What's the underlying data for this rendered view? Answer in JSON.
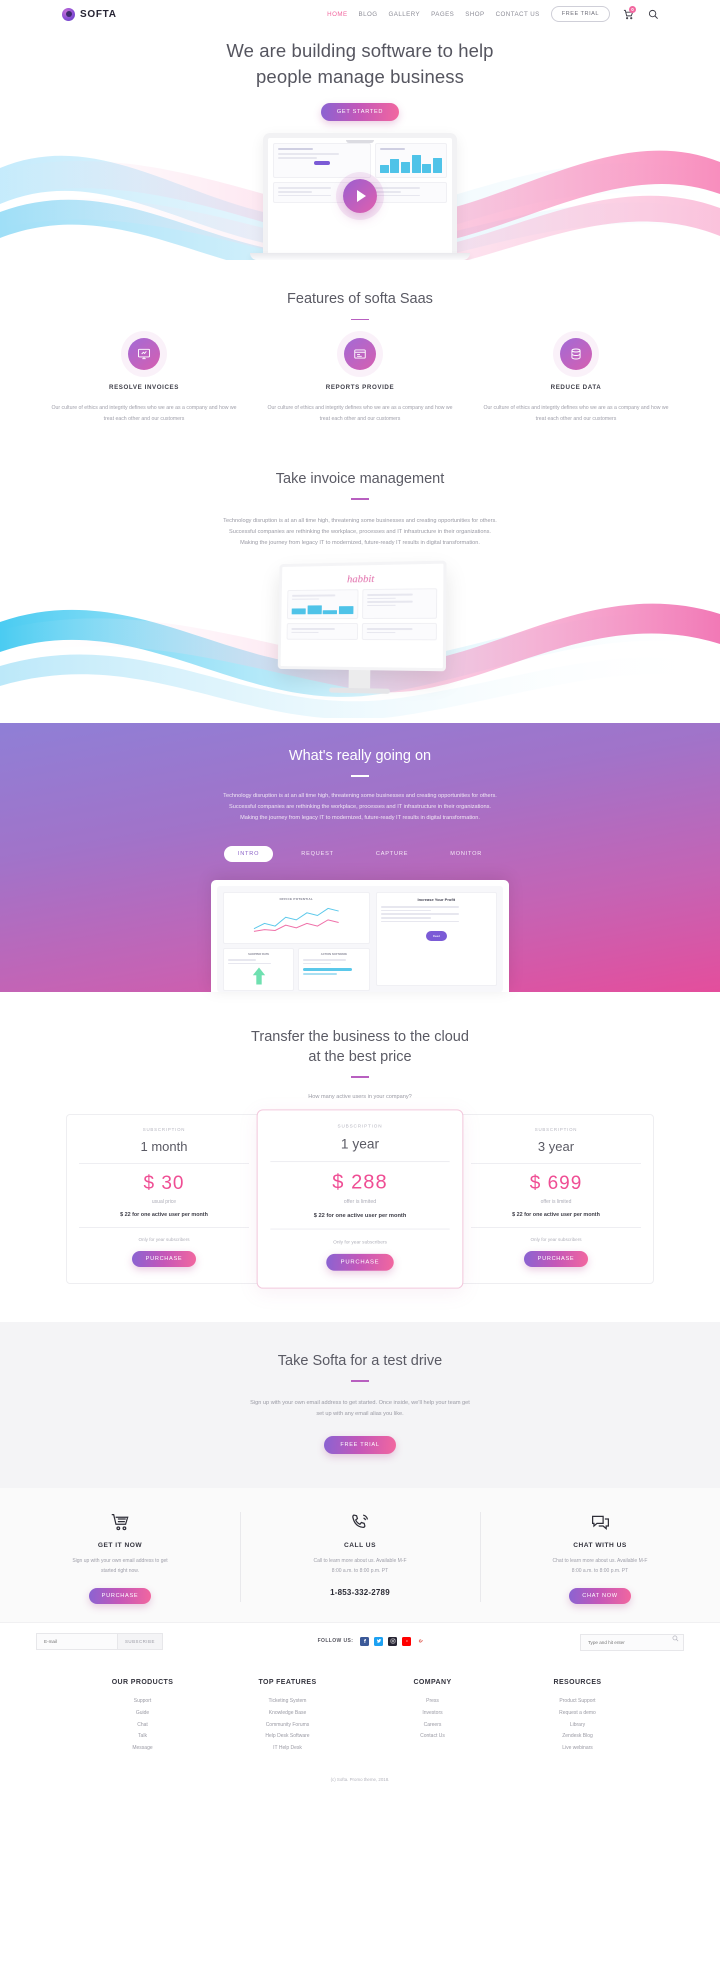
{
  "header": {
    "brand": "SOFTA",
    "nav": [
      {
        "label": "HOME",
        "active": true
      },
      {
        "label": "BLOG",
        "active": false
      },
      {
        "label": "GALLERY",
        "active": false
      },
      {
        "label": "PAGES",
        "active": false
      },
      {
        "label": "SHOP",
        "active": false
      },
      {
        "label": "CONTACT US",
        "active": false
      }
    ],
    "free_trial": "FREE TRIAL",
    "cart_count": "0"
  },
  "hero": {
    "title_line1": "We are building software to help",
    "title_line2": "people manage business",
    "cta": "GET STARTED"
  },
  "features": {
    "title": "Features of softa Saas",
    "items": [
      {
        "icon": "monitor-icon",
        "name": "RESOLVE INVOICES",
        "text": "Our culture of ethics and integrity defines who we are as a company and how we treat each other and our customers"
      },
      {
        "icon": "report-icon",
        "name": "REPORTS PROVIDE",
        "text": "Our culture of ethics and integrity defines who we are as a company and how we treat each other and our customers"
      },
      {
        "icon": "database-icon",
        "name": "REDUCE DATA",
        "text": "Our culture of ethics and integrity defines who we are as a company and how we treat each other and our customers"
      }
    ]
  },
  "invoice": {
    "title": "Take invoice management",
    "desc_line1": "Technology disruption is at an all time high, threatening some businesses and creating opportunities for others.",
    "desc_line2": "Successful companies are rethinking the workplace, processes and IT infrastructure in their organizations.",
    "desc_line3": "Making the journey from legacy IT to modernized, future-ready IT results in digital transformation.",
    "screen_word": "habbit"
  },
  "going_on": {
    "title": "What's really going on",
    "desc_line1": "Technology disruption is at an all time high, threatening some businesses and creating opportunities for others.",
    "desc_line2": "Successful companies are rethinking the workplace, processes and IT infrastructure in their organizations.",
    "desc_line3": "Making the journey from legacy IT to modernized, future-ready IT results in digital transformation.",
    "tabs": [
      {
        "label": "INTRO",
        "active": true
      },
      {
        "label": "REQUEST",
        "active": false
      },
      {
        "label": "CAPTURE",
        "active": false
      },
      {
        "label": "MONITOR",
        "active": false
      }
    ],
    "panel": {
      "card_title": "OFFICE POTENTIAL",
      "promo_title": "Increase Your Profit",
      "promo_btn": "Read",
      "left_card_title": "SHOPPER RATE",
      "right_card_title": "ACTION SOFTWARE"
    }
  },
  "pricing": {
    "title_line1": "Transfer the business to the cloud",
    "title_line2": "at the best price",
    "question": "How many active users in your company?",
    "plans": [
      {
        "subscription": "SUBSCRIPTION",
        "name": "1 month",
        "price": "$ 30",
        "note": "usual price",
        "detail": "$ 22 for one active user per month",
        "only": "Only for year subscribers",
        "cta": "PURCHASE",
        "featured": false
      },
      {
        "subscription": "SUBSCRIPTION",
        "name": "1 year",
        "price": "$ 288",
        "note": "offer is limited",
        "detail": "$ 22 for one active user per month",
        "only": "Only for year subscribers",
        "cta": "PURCHASE",
        "featured": true
      },
      {
        "subscription": "SUBSCRIPTION",
        "name": "3 year",
        "price": "$ 699",
        "note": "offer is limited",
        "detail": "$ 22 for one active user per month",
        "only": "Only for year subscribers",
        "cta": "PURCHASE",
        "featured": false
      }
    ]
  },
  "testdrive": {
    "title": "Take Softa for a test drive",
    "desc_line1": "Sign up with your own email address to get started. Once inside, we'll help your team get",
    "desc_line2": "set up with any email alias you like.",
    "cta": "FREE TRIAL"
  },
  "contact": {
    "columns": [
      {
        "icon": "cart-icon",
        "name": "GET IT NOW",
        "line1": "Sign up with your own email address to get",
        "line2": "started right now.",
        "cta": "PURCHASE",
        "phone": ""
      },
      {
        "icon": "phone-icon",
        "name": "CALL US",
        "line1": "Call to learn more about us. Available M-F",
        "line2": "8:00 a.m. to 8:00 p.m. PT",
        "cta": "",
        "phone": "1-853-332-2789"
      },
      {
        "icon": "chat-icon",
        "name": "CHAT WITH US",
        "line1": "Chat to learn more about us. Available M-F",
        "line2": "8:00 a.m. to 8:00 p.m. PT",
        "cta": "CHAT NOW",
        "phone": ""
      }
    ]
  },
  "socialbar": {
    "newsletter_placeholder": "E-mail",
    "subscribe": "SUBSCRIBE",
    "follow_label": "FOLLOW US:",
    "socials": [
      {
        "name": "facebook-icon",
        "color": "#3b5998",
        "glyph": "f"
      },
      {
        "name": "twitter-icon",
        "color": "#1da1f2",
        "glyph": "t"
      },
      {
        "name": "instagram-icon",
        "color": "#262433",
        "glyph": "i"
      },
      {
        "name": "youtube-icon",
        "color": "#ff0000",
        "glyph": "y"
      },
      {
        "name": "google-plus-icon",
        "color": "#db4437",
        "glyph": "g"
      }
    ],
    "search_placeholder": "Type and hit enter"
  },
  "footer": {
    "columns": [
      {
        "title": "OUR PRODUCTS",
        "links": [
          "Support",
          "Guide",
          "Chat",
          "Talk",
          "Message"
        ]
      },
      {
        "title": "TOP FEATURES",
        "links": [
          "Ticketing System",
          "Knowledge Base",
          "Community Forums",
          "Help Desk Software",
          "IT Help Desk"
        ]
      },
      {
        "title": "COMPANY",
        "links": [
          "Press",
          "Investors",
          "Careers",
          "Contact Us"
        ]
      },
      {
        "title": "RESOURCES",
        "links": [
          "Product Support",
          "Request a demo",
          "Library",
          "Zendesk Blog",
          "Live webinars"
        ]
      }
    ],
    "copyright": "(c) Softa. Promo theme, 2018."
  },
  "colors": {
    "accent_pink": "#ef4e94",
    "accent_purple": "#8a63d2",
    "rule": "#b85fc0"
  }
}
